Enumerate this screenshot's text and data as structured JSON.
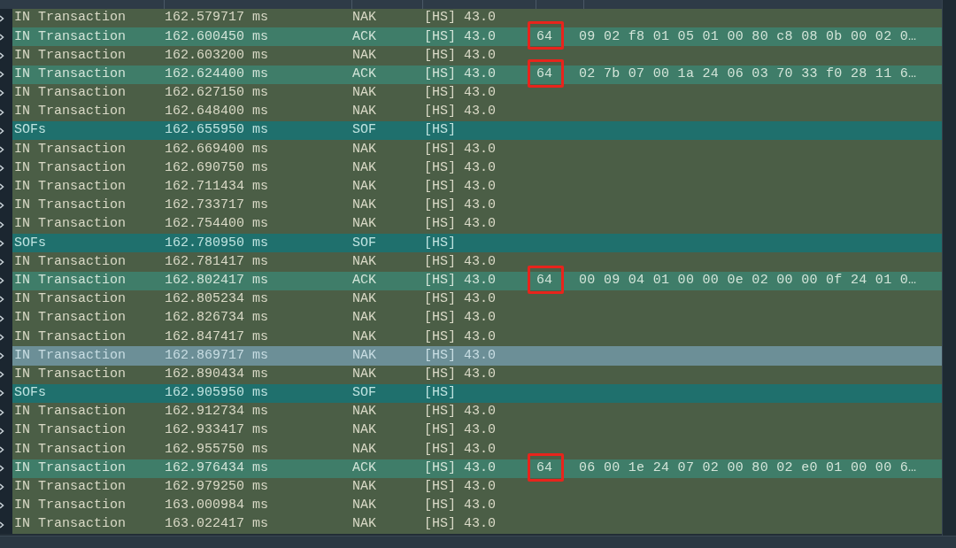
{
  "rows": [
    {
      "kind": "nak",
      "selected": false,
      "name": "IN Transaction",
      "time": "162.579717 ms",
      "status": "NAK",
      "speed": "[HS] 43.0"
    },
    {
      "kind": "ack",
      "selected": false,
      "boxed": true,
      "name": "IN Transaction",
      "time": "162.600450 ms",
      "status": "ACK",
      "speed": "[HS] 43.0",
      "length": "64",
      "data": "09 02 f8 01 05 01 00 80 c8 08 0b 00 02 0…"
    },
    {
      "kind": "nak",
      "selected": false,
      "name": "IN Transaction",
      "time": "162.603200 ms",
      "status": "NAK",
      "speed": "[HS] 43.0"
    },
    {
      "kind": "ack",
      "selected": false,
      "boxed": true,
      "name": "IN Transaction",
      "time": "162.624400 ms",
      "status": "ACK",
      "speed": "[HS] 43.0",
      "length": "64",
      "data": "02 7b 07 00 1a 24 06 03 70 33 f0 28 11 6…"
    },
    {
      "kind": "nak",
      "selected": false,
      "name": "IN Transaction",
      "time": "162.627150 ms",
      "status": "NAK",
      "speed": "[HS] 43.0"
    },
    {
      "kind": "nak",
      "selected": false,
      "name": "IN Transaction",
      "time": "162.648400 ms",
      "status": "NAK",
      "speed": "[HS] 43.0"
    },
    {
      "kind": "sof",
      "selected": false,
      "name": "SOFs",
      "time": "162.655950 ms",
      "status": "SOF",
      "speed": "[HS]"
    },
    {
      "kind": "nak",
      "selected": false,
      "name": "IN Transaction",
      "time": "162.669400 ms",
      "status": "NAK",
      "speed": "[HS] 43.0"
    },
    {
      "kind": "nak",
      "selected": false,
      "name": "IN Transaction",
      "time": "162.690750 ms",
      "status": "NAK",
      "speed": "[HS] 43.0"
    },
    {
      "kind": "nak",
      "selected": false,
      "name": "IN Transaction",
      "time": "162.711434 ms",
      "status": "NAK",
      "speed": "[HS] 43.0"
    },
    {
      "kind": "nak",
      "selected": false,
      "name": "IN Transaction",
      "time": "162.733717 ms",
      "status": "NAK",
      "speed": "[HS] 43.0"
    },
    {
      "kind": "nak",
      "selected": false,
      "name": "IN Transaction",
      "time": "162.754400 ms",
      "status": "NAK",
      "speed": "[HS] 43.0"
    },
    {
      "kind": "sof",
      "selected": false,
      "name": "SOFs",
      "time": "162.780950 ms",
      "status": "SOF",
      "speed": "[HS]"
    },
    {
      "kind": "nak",
      "selected": false,
      "name": "IN Transaction",
      "time": "162.781417 ms",
      "status": "NAK",
      "speed": "[HS] 43.0"
    },
    {
      "kind": "ack",
      "selected": false,
      "boxed": true,
      "name": "IN Transaction",
      "time": "162.802417 ms",
      "status": "ACK",
      "speed": "[HS] 43.0",
      "length": "64",
      "data": "00 09 04 01 00 00 0e 02 00 00 0f 24 01 0…"
    },
    {
      "kind": "nak",
      "selected": false,
      "name": "IN Transaction",
      "time": "162.805234 ms",
      "status": "NAK",
      "speed": "[HS] 43.0"
    },
    {
      "kind": "nak",
      "selected": false,
      "name": "IN Transaction",
      "time": "162.826734 ms",
      "status": "NAK",
      "speed": "[HS] 43.0"
    },
    {
      "kind": "nak",
      "selected": false,
      "name": "IN Transaction",
      "time": "162.847417 ms",
      "status": "NAK",
      "speed": "[HS] 43.0"
    },
    {
      "kind": "nak",
      "selected": true,
      "name": "IN Transaction",
      "time": "162.869717 ms",
      "status": "NAK",
      "speed": "[HS] 43.0"
    },
    {
      "kind": "nak",
      "selected": false,
      "name": "IN Transaction",
      "time": "162.890434 ms",
      "status": "NAK",
      "speed": "[HS] 43.0"
    },
    {
      "kind": "sof",
      "selected": false,
      "name": "SOFs",
      "time": "162.905950 ms",
      "status": "SOF",
      "speed": "[HS]"
    },
    {
      "kind": "nak",
      "selected": false,
      "name": "IN Transaction",
      "time": "162.912734 ms",
      "status": "NAK",
      "speed": "[HS] 43.0"
    },
    {
      "kind": "nak",
      "selected": false,
      "name": "IN Transaction",
      "time": "162.933417 ms",
      "status": "NAK",
      "speed": "[HS] 43.0"
    },
    {
      "kind": "nak",
      "selected": false,
      "name": "IN Transaction",
      "time": "162.955750 ms",
      "status": "NAK",
      "speed": "[HS] 43.0"
    },
    {
      "kind": "ack",
      "selected": false,
      "boxed": true,
      "name": "IN Transaction",
      "time": "162.976434 ms",
      "status": "ACK",
      "speed": "[HS] 43.0",
      "length": "64",
      "data": "06 00 1e 24 07 02 00 80 02 e0 01 00 00 6…"
    },
    {
      "kind": "nak",
      "selected": false,
      "name": "IN Transaction",
      "time": "162.979250 ms",
      "status": "NAK",
      "speed": "[HS] 43.0"
    },
    {
      "kind": "nak",
      "selected": false,
      "name": "IN Transaction",
      "time": "163.000984 ms",
      "status": "NAK",
      "speed": "[HS] 43.0"
    },
    {
      "kind": "nak",
      "selected": false,
      "name": "IN Transaction",
      "time": "163.022417 ms",
      "status": "NAK",
      "speed": "[HS] 43.0"
    }
  ]
}
